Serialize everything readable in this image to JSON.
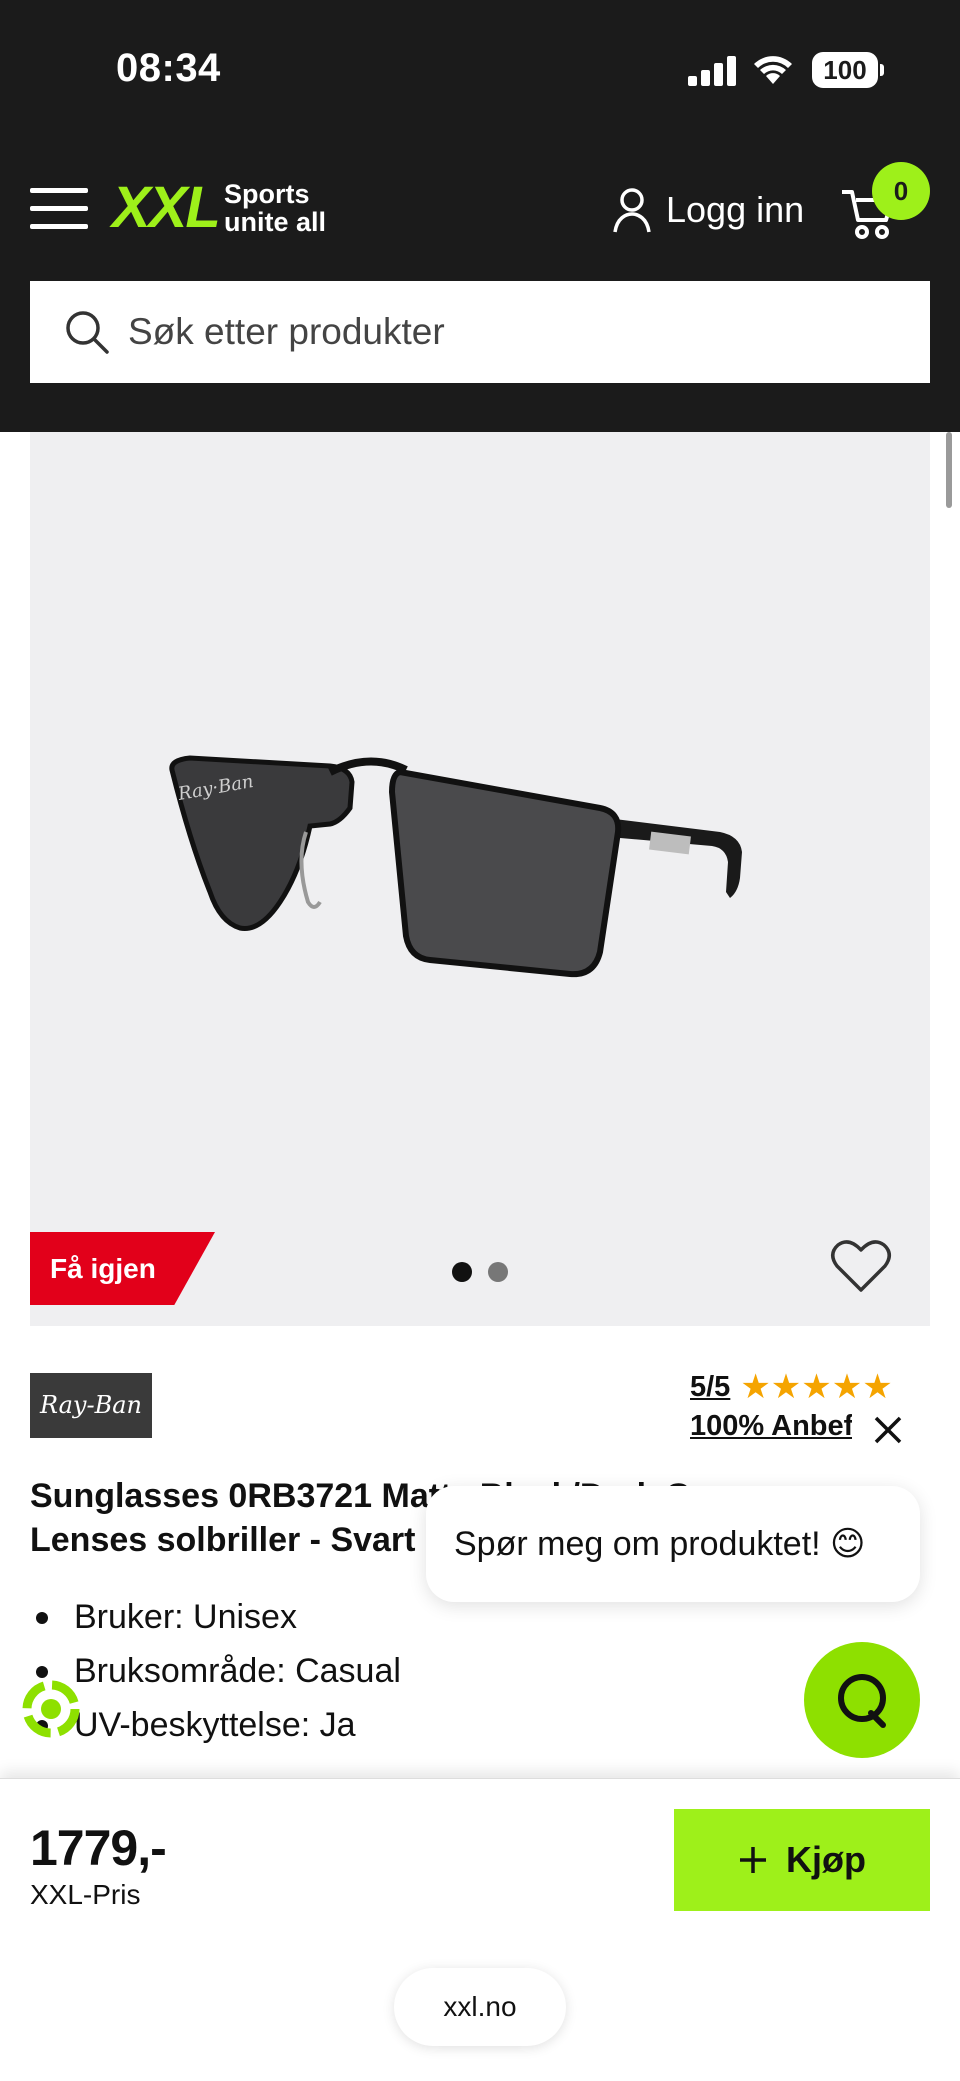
{
  "status_bar": {
    "time": "08:34",
    "battery": "100"
  },
  "header": {
    "logo_text": "XXL",
    "logo_tagline_1": "Sports",
    "logo_tagline_2": "unite all",
    "login_label": "Logg inn",
    "cart_count": "0"
  },
  "search": {
    "placeholder": "Søk etter produkter"
  },
  "gallery": {
    "promo_badge": "Få igjen",
    "image_count": 2,
    "active_index": 0
  },
  "product": {
    "brand": "Ray-Ban",
    "rating_score": "5/5",
    "rating_stars": 5,
    "recommend_text": "100% Anbefaler",
    "title": "Sunglasses 0RB3721 Matte Black/Dark Grey Lenses solbriller - Svart",
    "features": [
      "Bruker: Unisex",
      "Bruksområde: Casual",
      "UV-beskyttelse: Ja"
    ]
  },
  "chat": {
    "bubble_text": "Spør meg om produktet! 😊"
  },
  "buy_bar": {
    "price": "1779,-",
    "price_label": "XXL-Pris",
    "buy_label": "Kjøp"
  },
  "browser": {
    "url": "xxl.no"
  },
  "colors": {
    "header_bg": "#1b1b1b",
    "brand_green": "#9ef01a",
    "promo_red": "#e2001a",
    "star_yellow": "#f5a400"
  }
}
